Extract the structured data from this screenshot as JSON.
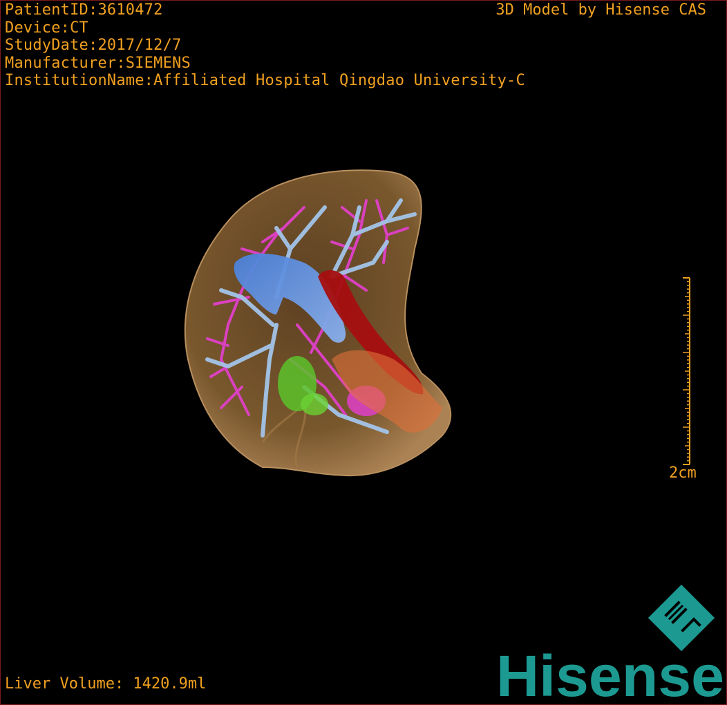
{
  "patient": {
    "id_line": "PatientID:3610472",
    "device_line": "Device:CT",
    "date_line": "StudyDate:2017/12/7",
    "manufacturer_line": "Manufacturer:SIEMENS",
    "institution_line": "InstitutionName:Affiliated Hospital Qingdao University-C"
  },
  "header": {
    "model_credit": "3D Model by Hisense CAS"
  },
  "footer": {
    "liver_volume": "Liver Volume: 1420.9ml"
  },
  "scale_bar": {
    "label": "2cm"
  },
  "logo": {
    "wordmark": "Hisense",
    "mark_icon": "hisense-hl-diamond-icon"
  },
  "colors": {
    "overlay_text": "#f0a020",
    "liver": "#c9965a",
    "portal_vein": "#9fc2e6",
    "hepatic_vein": "#e040c8",
    "ivc": "#5b8fe0",
    "artery": "#b01010",
    "gallbladder": "#5cc22a",
    "brand_teal": "#1c9a92"
  }
}
